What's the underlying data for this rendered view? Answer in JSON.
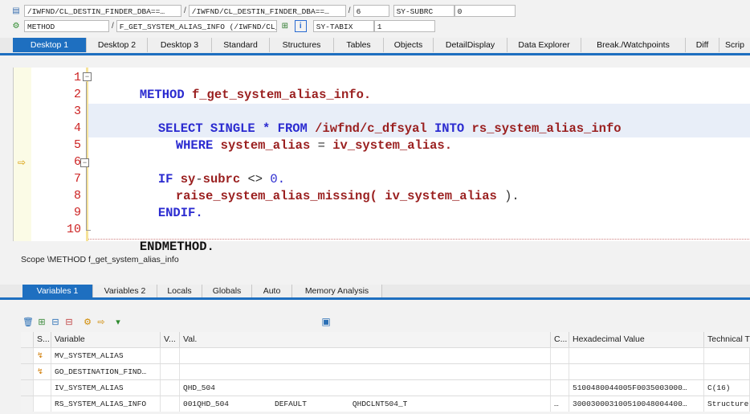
{
  "header": {
    "row1": {
      "field1": "/IWFND/CL_DESTIN_FINDER_DBA==…",
      "field2": "/IWFND/CL_DESTIN_FINDER_DBA==…",
      "line": "6",
      "var_name": "SY-SUBRC",
      "var_value": "0"
    },
    "row2": {
      "type": "METHOD",
      "method": "F_GET_SYSTEM_ALIAS_INFO (/IWFND/CL_DESTIN_FIN…",
      "var_name": "SY-TABIX",
      "var_value": "1"
    }
  },
  "desktop_tabs": [
    "Desktop 1",
    "Desktop 2",
    "Desktop 3",
    "Standard",
    "Structures",
    "Tables",
    "Objects",
    "DetailDisplay",
    "Data Explorer",
    "Break./Watchpoints",
    "Diff",
    "Scrip"
  ],
  "editor": {
    "line_numbers": [
      "1",
      "2",
      "3",
      "4",
      "5",
      "6",
      "7",
      "8",
      "9",
      "10"
    ],
    "lines": {
      "l1_kw": "METHOD",
      "l1_id": "f_get_system_alias_info.",
      "l3_a": "SELECT SINGLE * FROM",
      "l3_b": "/iwfnd/c_dfsyal",
      "l3_c": "INTO",
      "l3_d": "rs_system_alias_info",
      "l4_a": "WHERE",
      "l4_b": "system_alias",
      "l4_c": "=",
      "l4_d": "iv_system_alias.",
      "l6_a": "IF",
      "l6_b": "sy",
      "l6_c": "-",
      "l6_d": "subrc",
      "l6_e": "<>",
      "l6_f": "0.",
      "l7_a": "raise_system_alias_missing(",
      "l7_b": "iv_system_alias",
      "l7_c": ").",
      "l8": "ENDIF.",
      "l10": "ENDMETHOD."
    }
  },
  "scope": "Scope \\METHOD f_get_system_alias_info",
  "variable_tabs": [
    "Variables 1",
    "Variables 2",
    "Locals",
    "Globals",
    "Auto",
    "Memory Analysis"
  ],
  "table": {
    "headers": [
      "S...",
      "Variable",
      "V...",
      "Val.",
      "C...",
      "Hexadecimal Value",
      "Technical T"
    ],
    "rows": [
      {
        "variable": "MV_SYSTEM_ALIAS",
        "val": "",
        "hex": "",
        "tech": ""
      },
      {
        "variable": "GO_DESTINATION_FIND…",
        "val": "",
        "hex": "",
        "tech": ""
      },
      {
        "variable": "IV_SYSTEM_ALIAS",
        "val": "QHD_504",
        "hex": "5100480044005F0035003000…",
        "tech": "C(16)"
      },
      {
        "variable": "RS_SYSTEM_ALIAS_INFO",
        "val": "001QHD_504          DEFAULT          QHDCLNT504_T",
        "c": "…",
        "hex": "300030003100510048004400…",
        "tech": "Structure:"
      }
    ]
  }
}
